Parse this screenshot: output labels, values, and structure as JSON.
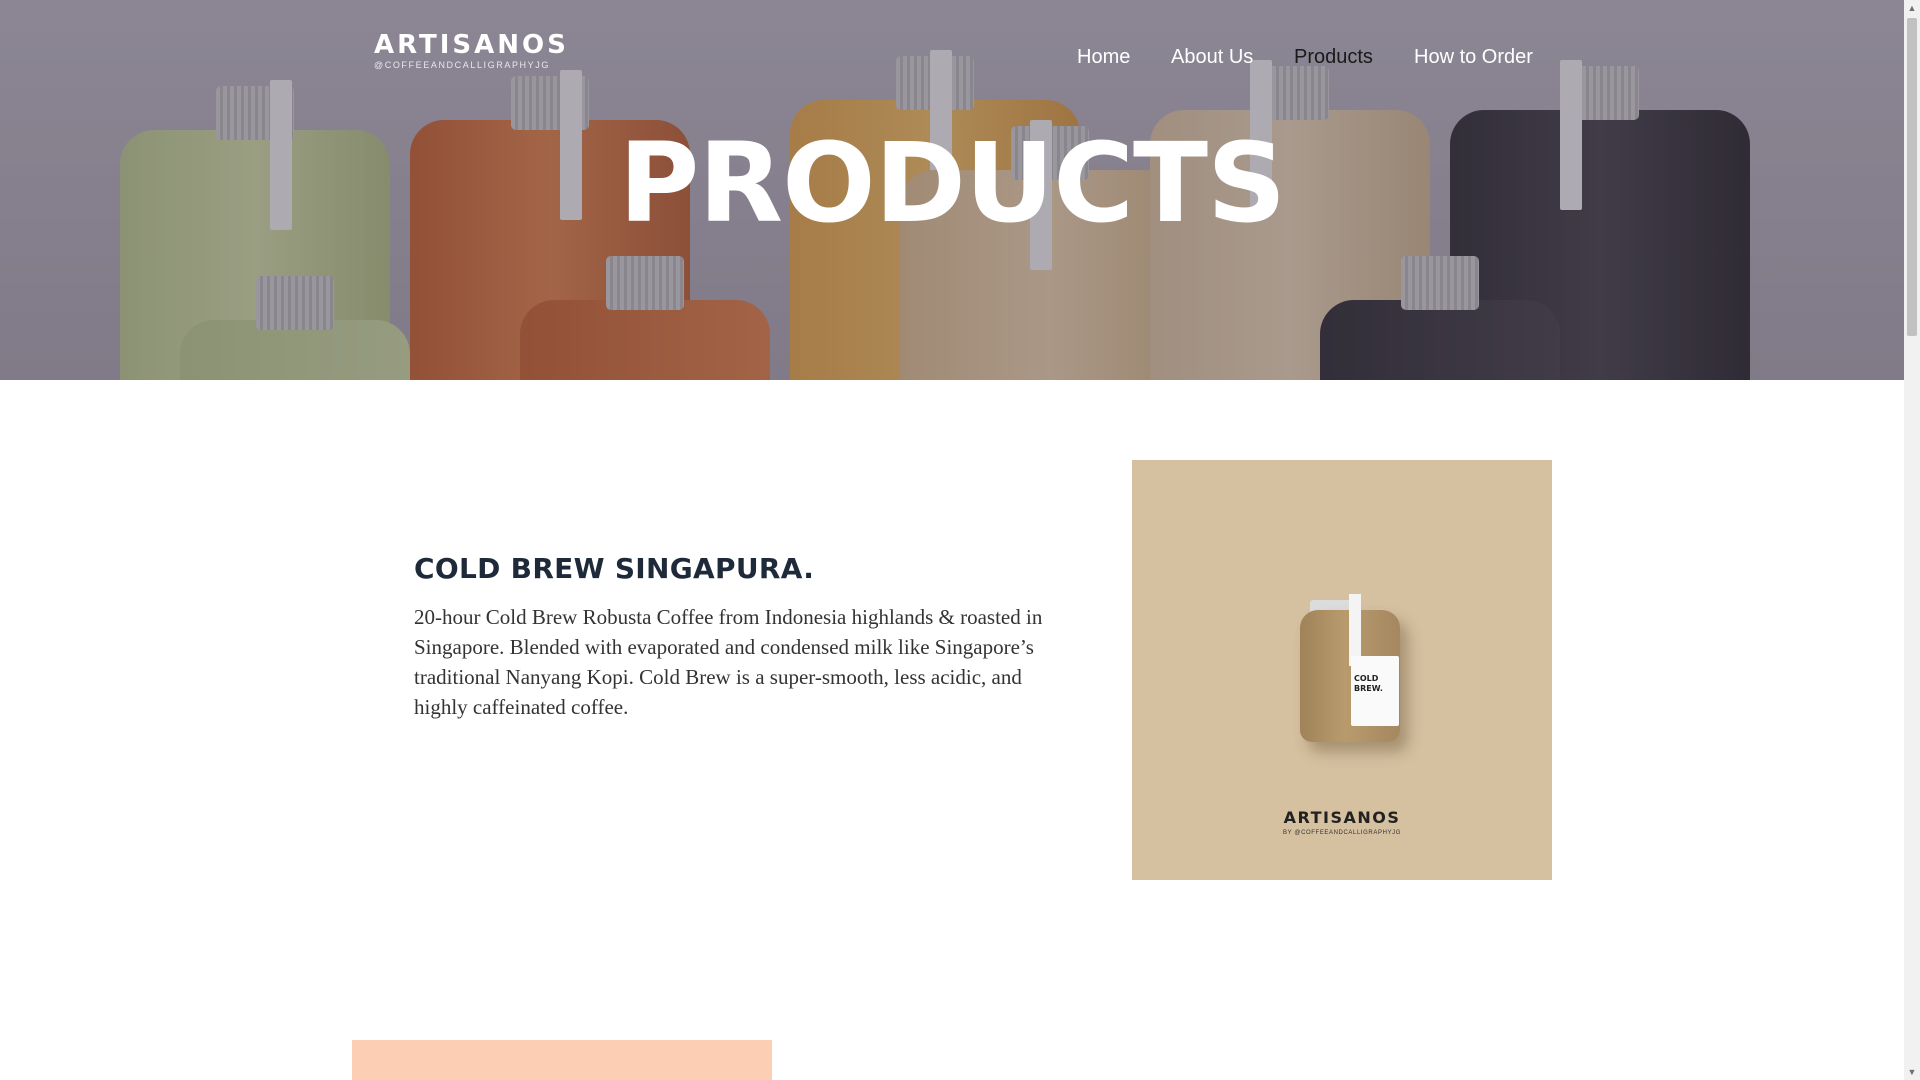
{
  "header": {
    "logo": "ARTISANOS",
    "logo_sub": "@COFFEEANDCALLIGRAPHYJG",
    "nav": [
      {
        "label": "Home"
      },
      {
        "label": "About Us"
      },
      {
        "label": "Products",
        "active": true
      },
      {
        "label": "How to Order"
      }
    ]
  },
  "hero": {
    "title": "PRODUCTS"
  },
  "product": {
    "title": "COLD BREW SINGAPURA.",
    "description": "20-hour Cold Brew Robusta Coffee from Indonesia highlands & roasted in Singapore. Blended with evaporated and condensed milk  like Singapore’s traditional Nanyang Kopi. Cold Brew is a super-smooth, less acidic, and highly caffeinated coffee.",
    "image": {
      "label": "COLD BREW.",
      "brand": "ARTISANOS",
      "brand_sub": "BY @COFFEEANDCALLIGRAPHYJG",
      "background": "#d5c0a0"
    }
  },
  "colors": {
    "hero_overlay": "#4e485a",
    "title_text": "#1e2a3a",
    "next_card": "#fccfb5"
  },
  "icons": {
    "scroll_up": "▲",
    "scroll_down": "▼"
  }
}
